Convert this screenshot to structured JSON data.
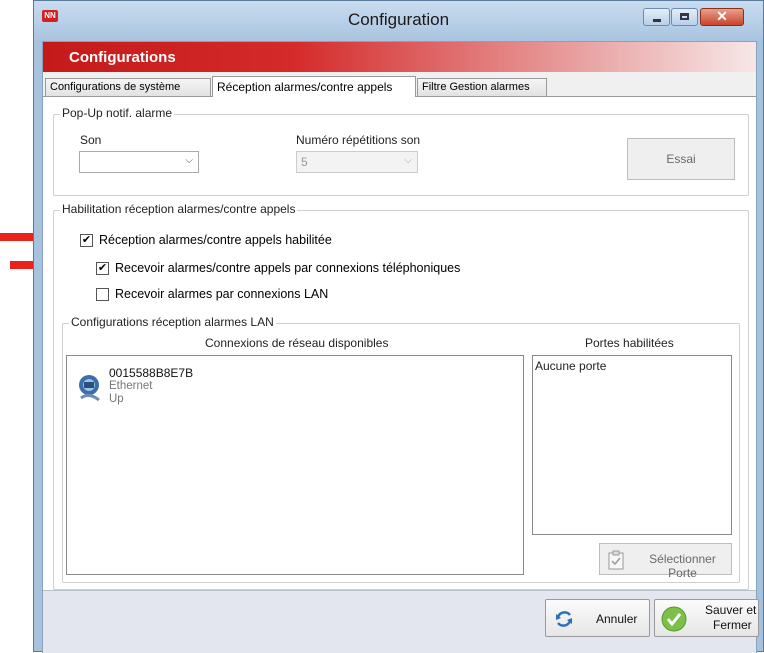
{
  "window": {
    "title": "Configuration",
    "app_icon_text": "NN"
  },
  "banner": {
    "title": "Configurations"
  },
  "tabs": [
    {
      "label": "Configurations de système"
    },
    {
      "label": "Réception alarmes/contre appels"
    },
    {
      "label": "Filtre Gestion alarmes"
    }
  ],
  "popup_group": {
    "legend": "Pop-Up notif. alarme",
    "son_label": "Son",
    "son_value": "",
    "repetitions_label": "Numéro répétitions son",
    "repetitions_value": "5",
    "test_button": "Essai"
  },
  "habilitation_group": {
    "legend": "Habilitation réception alarmes/contre appels",
    "checkboxes": [
      {
        "label": "Réception alarmes/contre appels habilitée",
        "checked": true
      },
      {
        "label": "Recevoir alarmes/contre appels par connexions téléphoniques",
        "checked": true
      },
      {
        "label": "Recevoir alarmes par connexions LAN",
        "checked": false
      }
    ]
  },
  "lan_group": {
    "legend": "Configurations réception alarmes LAN",
    "connections_header": "Connexions de réseau disponibles",
    "ports_header": "Portes habilitées",
    "connection": {
      "name": "0015588B8E7B",
      "type": "Ethernet",
      "status": "Up"
    },
    "ports_empty": "Aucune porte",
    "select_port_button": "Sélectionner Porte"
  },
  "footer": {
    "cancel_button": "Annuler",
    "save_button_line1": "Sauver et",
    "save_button_line2": "Fermer"
  },
  "colors": {
    "banner_red": "#c41a1a",
    "annotation_arrow": "#e8231c"
  }
}
